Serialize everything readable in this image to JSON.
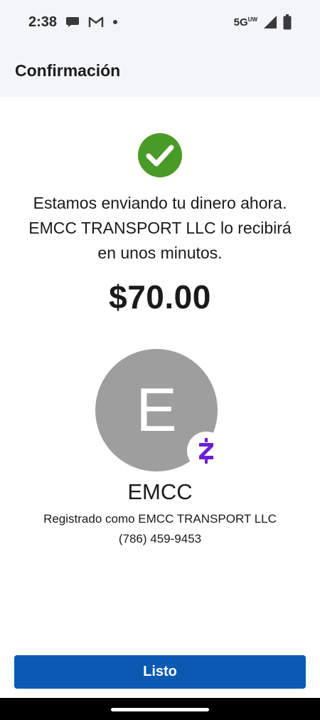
{
  "status_bar": {
    "time": "2:38",
    "network": "5G",
    "network_sub": "UW"
  },
  "header": {
    "title": "Confirmación"
  },
  "confirmation": {
    "icon": "check-circle-icon",
    "icon_color": "#4a9a27",
    "message_lines": [
      "Estamos enviando tu dinero ahora.",
      "EMCC TRANSPORT LLC lo recibirá",
      "en unos minutos."
    ],
    "amount": "$70.00"
  },
  "recipient": {
    "avatar_letter": "E",
    "avatar_color": "#9e9e9e",
    "badge_letter": "Z",
    "badge_color": "#6d1ed4",
    "name": "EMCC",
    "registered_as": "Registrado como EMCC TRANSPORT LLC",
    "phone": "(786) 459-9453"
  },
  "actions": {
    "done_label": "Listo",
    "done_color": "#0a5ab4"
  }
}
